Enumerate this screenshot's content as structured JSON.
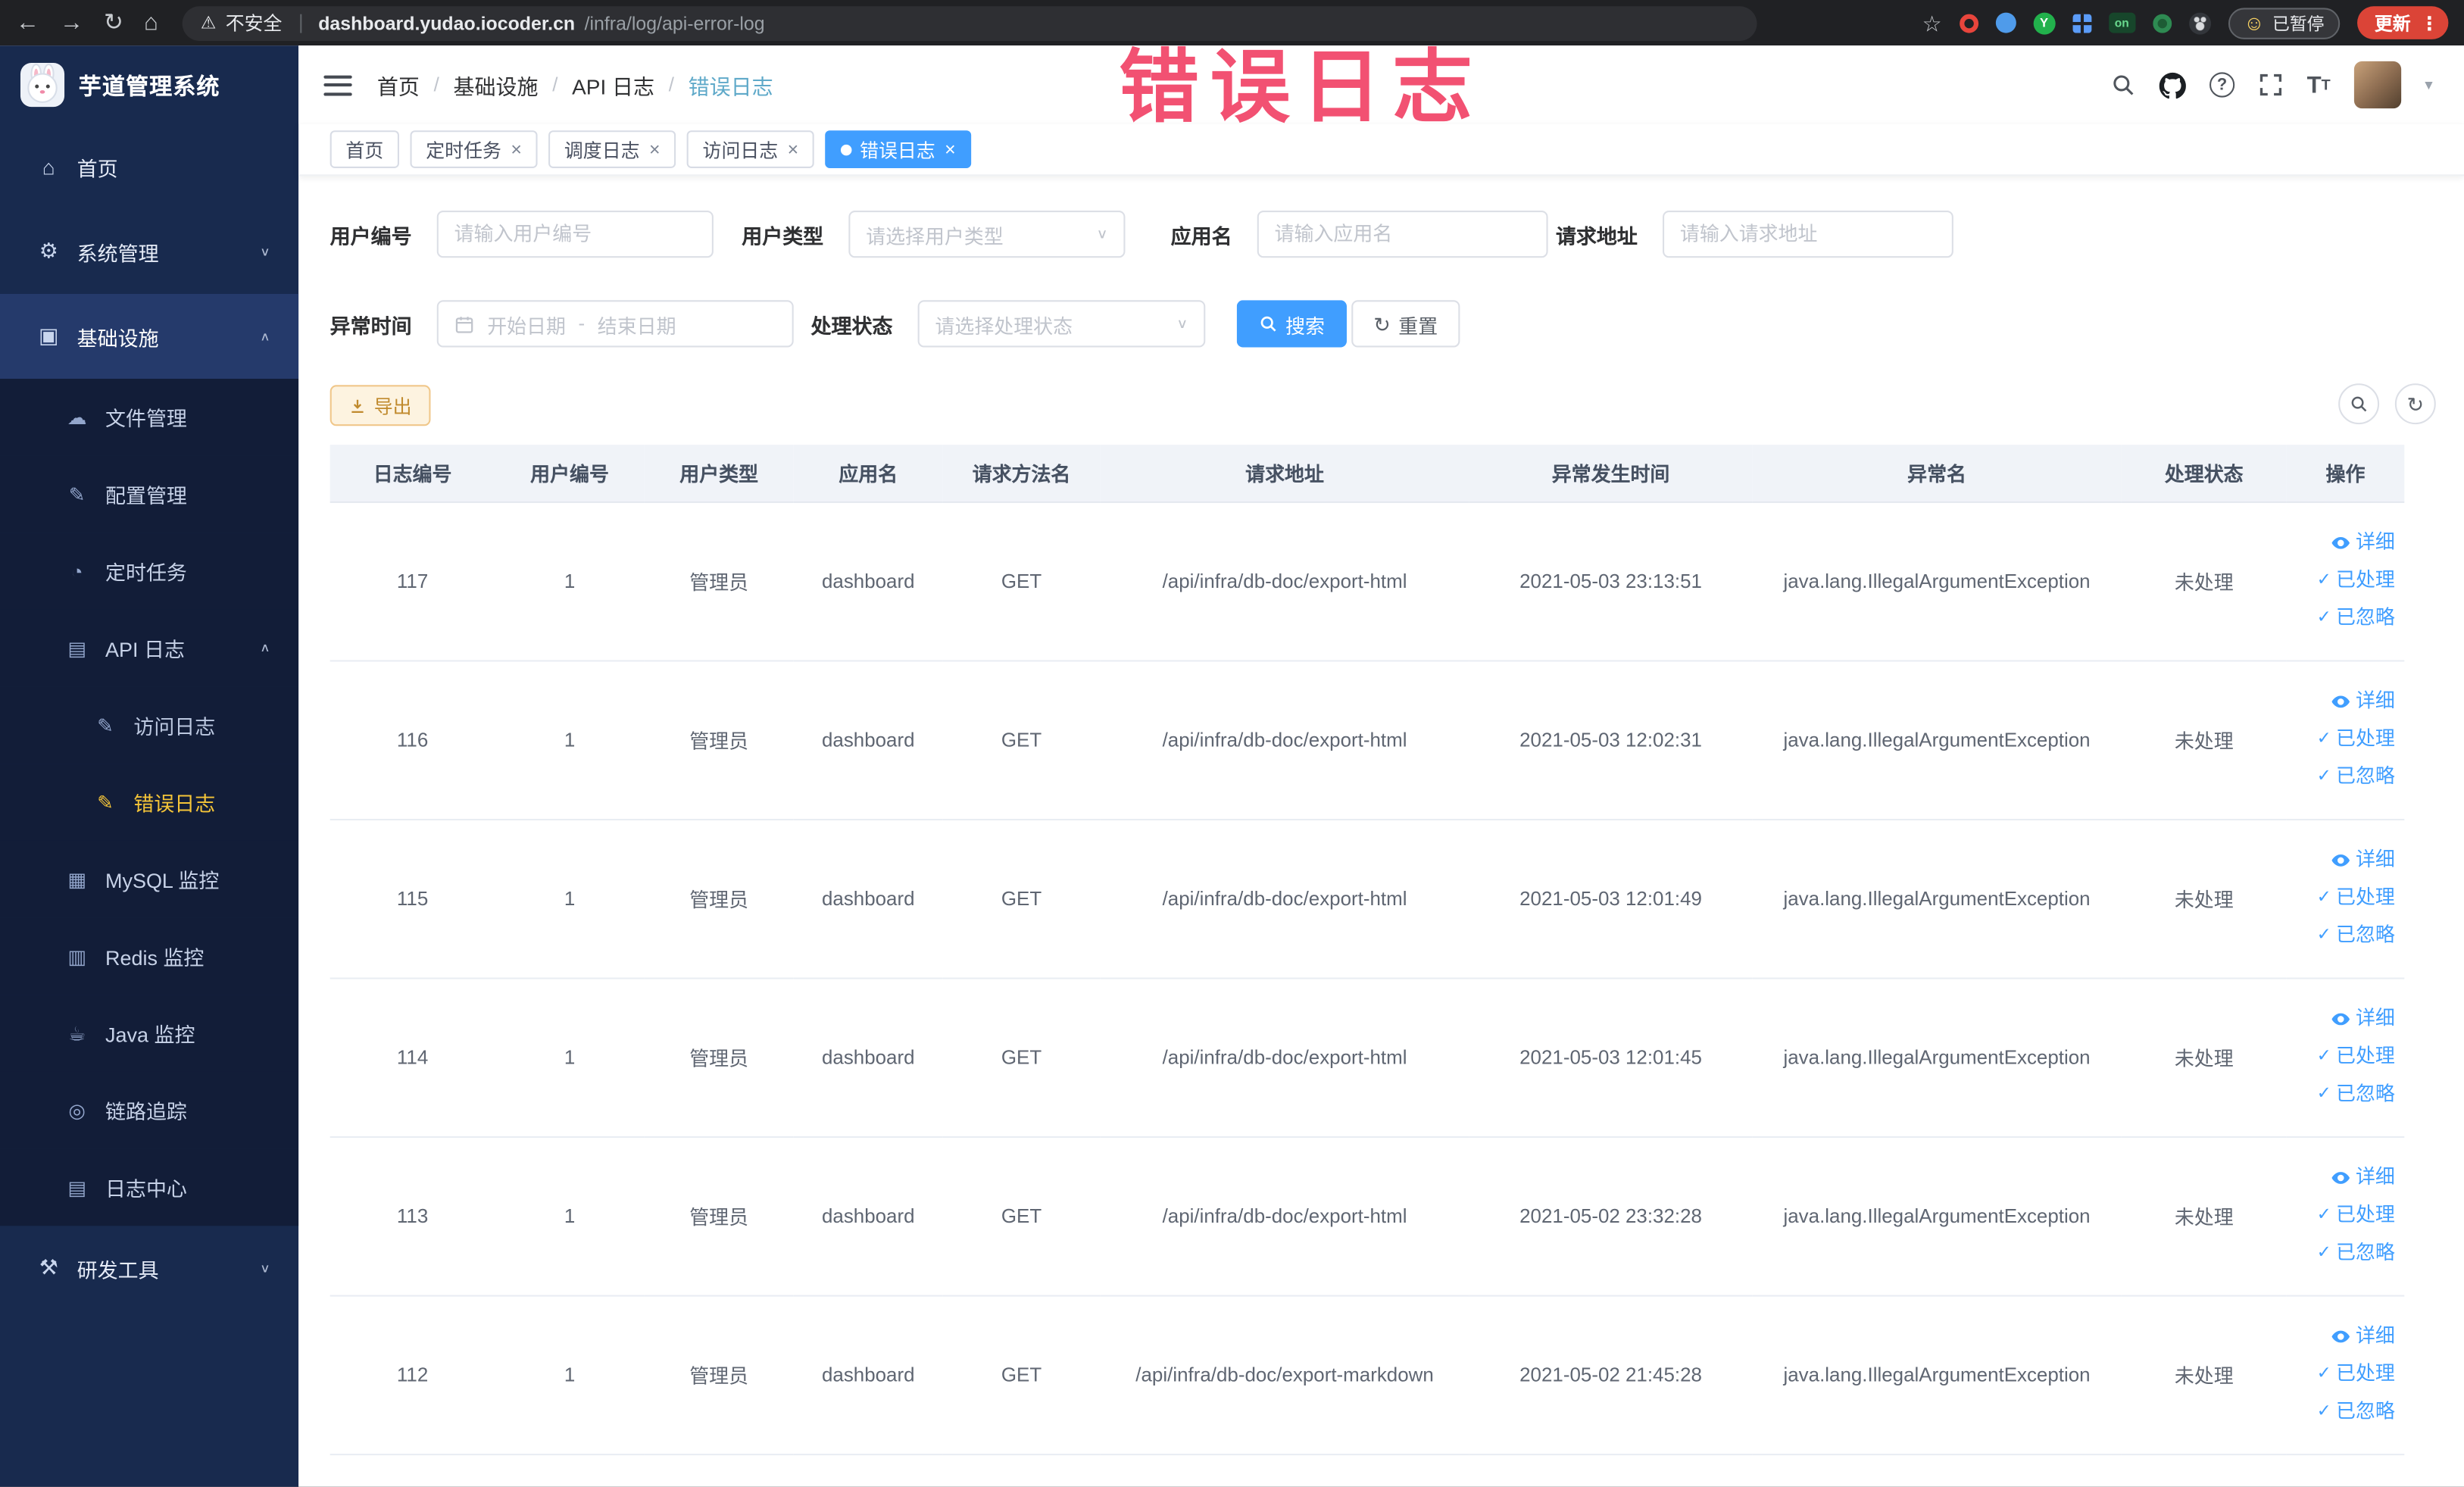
{
  "watermark": "错误日志",
  "palette": {
    "accent": "#409eff",
    "sidebar_bg": "#182a4e",
    "sidebar_submenu_bg": "#121d38",
    "sidebar_active_item": "#f5c538",
    "watermark_color": "#f2486b",
    "warning": "#e6a23c",
    "update_button": "#db4437"
  },
  "browser": {
    "security_label": "不安全",
    "url_host": "dashboard.yudao.iocoder.cn",
    "url_path": "/infra/log/api-error-log",
    "extension_on_badge": "on",
    "paused_button": "已暂停",
    "update_button": "更新"
  },
  "sidebar": {
    "app_title": "芋道管理系统",
    "items": [
      {
        "name": "home",
        "label": "首页",
        "level": 1
      },
      {
        "name": "system",
        "label": "系统管理",
        "level": 1,
        "chevron": "down"
      },
      {
        "name": "infra",
        "label": "基础设施",
        "level": 1,
        "chevron": "up",
        "open": true
      },
      {
        "name": "file",
        "label": "文件管理",
        "level": 2
      },
      {
        "name": "config",
        "label": "配置管理",
        "level": 2
      },
      {
        "name": "job",
        "label": "定时任务",
        "level": 2
      },
      {
        "name": "api-log",
        "label": "API 日志",
        "level": 2,
        "chevron": "up"
      },
      {
        "name": "access-log",
        "label": "访问日志",
        "level": 3
      },
      {
        "name": "error-log",
        "label": "错误日志",
        "level": 3,
        "active": true
      },
      {
        "name": "mysql",
        "label": "MySQL 监控",
        "level": 2
      },
      {
        "name": "redis",
        "label": "Redis 监控",
        "level": 2
      },
      {
        "name": "java",
        "label": "Java 监控",
        "level": 2
      },
      {
        "name": "trace",
        "label": "链路追踪",
        "level": 2
      },
      {
        "name": "log-center",
        "label": "日志中心",
        "level": 2
      },
      {
        "name": "dev-tools",
        "label": "研发工具",
        "level": 1,
        "chevron": "down"
      }
    ]
  },
  "header": {
    "breadcrumb": [
      "首页",
      "基础设施",
      "API 日志",
      "错误日志"
    ]
  },
  "tabs": [
    {
      "name": "home",
      "label": "首页",
      "closable": false,
      "active": false
    },
    {
      "name": "job",
      "label": "定时任务",
      "closable": true,
      "active": false
    },
    {
      "name": "job-log",
      "label": "调度日志",
      "closable": true,
      "active": false
    },
    {
      "name": "access-log",
      "label": "访问日志",
      "closable": true,
      "active": false
    },
    {
      "name": "error-log",
      "label": "错误日志",
      "closable": true,
      "active": true
    }
  ],
  "filters": {
    "user_id": {
      "label": "用户编号",
      "placeholder": "请输入用户编号"
    },
    "user_type": {
      "label": "用户类型",
      "placeholder": "请选择用户类型"
    },
    "app_name": {
      "label": "应用名",
      "placeholder": "请输入应用名"
    },
    "request_url": {
      "label": "请求地址",
      "placeholder": "请输入请求地址"
    },
    "exception_time": {
      "label": "异常时间",
      "start_placeholder": "开始日期",
      "end_placeholder": "结束日期",
      "separator": "-"
    },
    "process_status": {
      "label": "处理状态",
      "placeholder": "请选择处理状态"
    },
    "search_label": "搜索",
    "reset_label": "重置"
  },
  "toolbar": {
    "export_label": "导出"
  },
  "table": {
    "columns": [
      "日志编号",
      "用户编号",
      "用户类型",
      "应用名",
      "请求方法名",
      "请求地址",
      "异常发生时间",
      "异常名",
      "处理状态",
      "操作"
    ],
    "actions": [
      "详细",
      "已处理",
      "已忽略"
    ],
    "rows": [
      {
        "log_id": "117",
        "user_id": "1",
        "user_type": "管理员",
        "app_name": "dashboard",
        "method": "GET",
        "url": "/api/infra/db-doc/export-html",
        "time": "2021-05-03 23:13:51",
        "exception": "java.lang.IllegalArgumentException",
        "status": "未处理"
      },
      {
        "log_id": "116",
        "user_id": "1",
        "user_type": "管理员",
        "app_name": "dashboard",
        "method": "GET",
        "url": "/api/infra/db-doc/export-html",
        "time": "2021-05-03 12:02:31",
        "exception": "java.lang.IllegalArgumentException",
        "status": "未处理"
      },
      {
        "log_id": "115",
        "user_id": "1",
        "user_type": "管理员",
        "app_name": "dashboard",
        "method": "GET",
        "url": "/api/infra/db-doc/export-html",
        "time": "2021-05-03 12:01:49",
        "exception": "java.lang.IllegalArgumentException",
        "status": "未处理"
      },
      {
        "log_id": "114",
        "user_id": "1",
        "user_type": "管理员",
        "app_name": "dashboard",
        "method": "GET",
        "url": "/api/infra/db-doc/export-html",
        "time": "2021-05-03 12:01:45",
        "exception": "java.lang.IllegalArgumentException",
        "status": "未处理"
      },
      {
        "log_id": "113",
        "user_id": "1",
        "user_type": "管理员",
        "app_name": "dashboard",
        "method": "GET",
        "url": "/api/infra/db-doc/export-html",
        "time": "2021-05-02 23:32:28",
        "exception": "java.lang.IllegalArgumentException",
        "status": "未处理"
      },
      {
        "log_id": "112",
        "user_id": "1",
        "user_type": "管理员",
        "app_name": "dashboard",
        "method": "GET",
        "url": "/api/infra/db-doc/export-markdown",
        "time": "2021-05-02 21:45:28",
        "exception": "java.lang.IllegalArgumentException",
        "status": "未处理"
      }
    ]
  }
}
